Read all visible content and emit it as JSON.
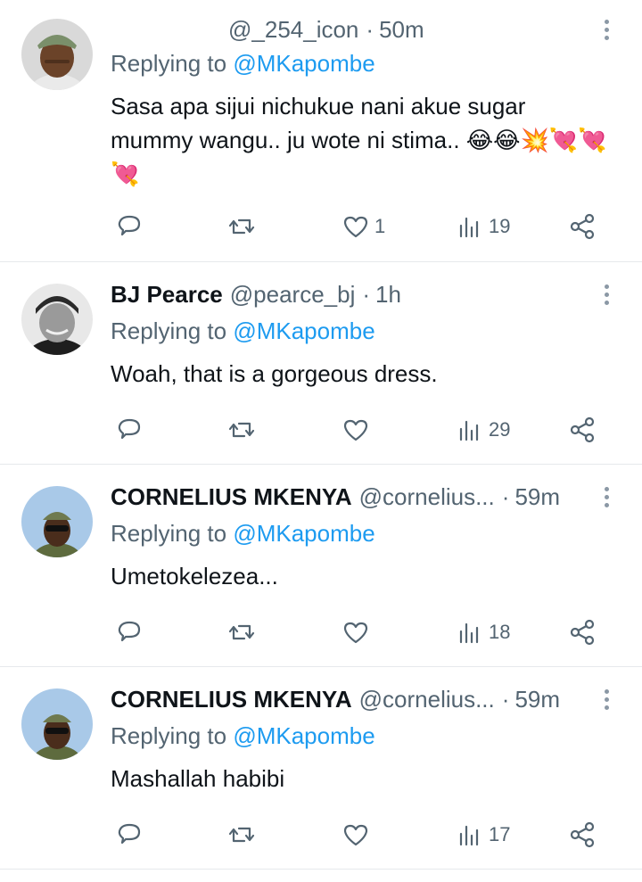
{
  "replying_label": "Replying to",
  "tweets": [
    {
      "name": "",
      "handle": "@_254_icon",
      "time": "50m",
      "mention": "@MKapombe",
      "body": "Sasa apa sijui nichukue nani akue sugar mummy wangu.. ju wote ni stima.. 😂😂💥💘💘💘",
      "likes": "1",
      "views": "19",
      "avatar_colors": {
        "bg": "#d9d9d9",
        "skin": "#6b4329",
        "cap": "#7a8f6a"
      }
    },
    {
      "name": "BJ Pearce",
      "handle": "@pearce_bj",
      "time": "1h",
      "mention": "@MKapombe",
      "body": "Woah, that is a gorgeous dress.",
      "likes": "",
      "views": "29",
      "avatar_colors": {
        "bg": "#e8e8e8",
        "skin": "#9a9a9a",
        "cap": "#2a2a2a"
      }
    },
    {
      "name": "CORNELIUS MKENYA",
      "handle": "@cornelius...",
      "time": "59m",
      "mention": "@MKapombe",
      "body": "Umetokelezea...",
      "likes": "",
      "views": "18",
      "avatar_colors": {
        "bg": "#a9c9e8",
        "skin": "#4a2d1c",
        "cap": "#6f7a4f"
      }
    },
    {
      "name": "CORNELIUS MKENYA",
      "handle": "@cornelius...",
      "time": "59m",
      "mention": "@MKapombe",
      "body": "Mashallah habibi",
      "likes": "",
      "views": "17",
      "avatar_colors": {
        "bg": "#a9c9e8",
        "skin": "#4a2d1c",
        "cap": "#6f7a4f"
      }
    }
  ],
  "icons": {
    "reply": "reply-icon",
    "retweet": "retweet-icon",
    "like": "heart-icon",
    "views": "views-icon",
    "share": "share-icon",
    "more": "more-icon"
  },
  "colors": {
    "accent": "#1d9bf0",
    "muted": "#536471",
    "text": "#0f1419",
    "divider": "#e6e9ec"
  }
}
